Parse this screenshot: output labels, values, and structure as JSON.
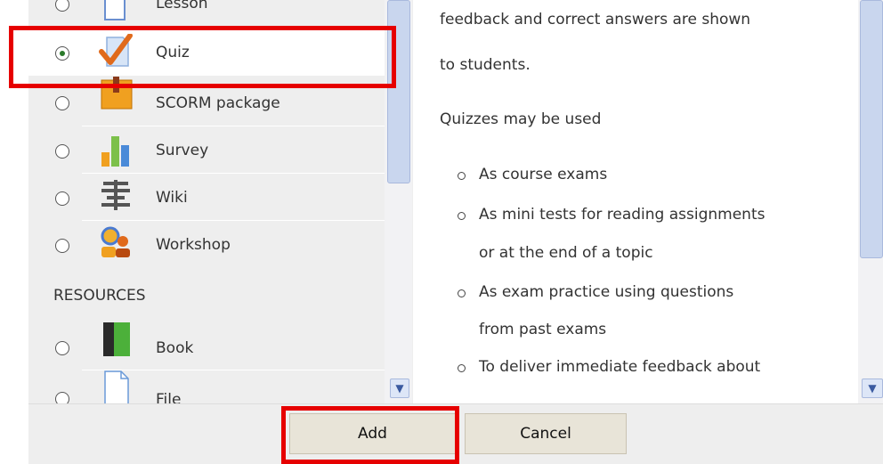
{
  "activities": [
    {
      "label": "Lesson",
      "icon": "lesson-icon",
      "selected": false
    },
    {
      "label": "Quiz",
      "icon": "quiz-icon",
      "selected": true
    },
    {
      "label": "SCORM package",
      "icon": "scorm-package-icon",
      "selected": false
    },
    {
      "label": "Survey",
      "icon": "survey-icon",
      "selected": false
    },
    {
      "label": "Wiki",
      "icon": "wiki-icon",
      "selected": false
    },
    {
      "label": "Workshop",
      "icon": "workshop-icon",
      "selected": false
    }
  ],
  "resources_heading": "RESOURCES",
  "resources": [
    {
      "label": "Book",
      "icon": "book-icon",
      "selected": false
    },
    {
      "label": "File",
      "icon": "file-icon",
      "selected": false
    }
  ],
  "description": {
    "line1": "feedback and correct answers are shown",
    "line2": "to students.",
    "intro": "Quizzes may be used",
    "bullets": [
      {
        "l1": "As course exams",
        "l2": ""
      },
      {
        "l1": "As mini tests for reading assignments",
        "l2": "or at the end of a topic"
      },
      {
        "l1": "As exam practice using questions",
        "l2": "from past exams"
      },
      {
        "l1": "To deliver immediate feedback about",
        "l2": ""
      }
    ]
  },
  "footer": {
    "add_label": "Add",
    "cancel_label": "Cancel"
  },
  "colors": {
    "highlight": "#e60000",
    "selected_radio": "#2a7a2a"
  }
}
